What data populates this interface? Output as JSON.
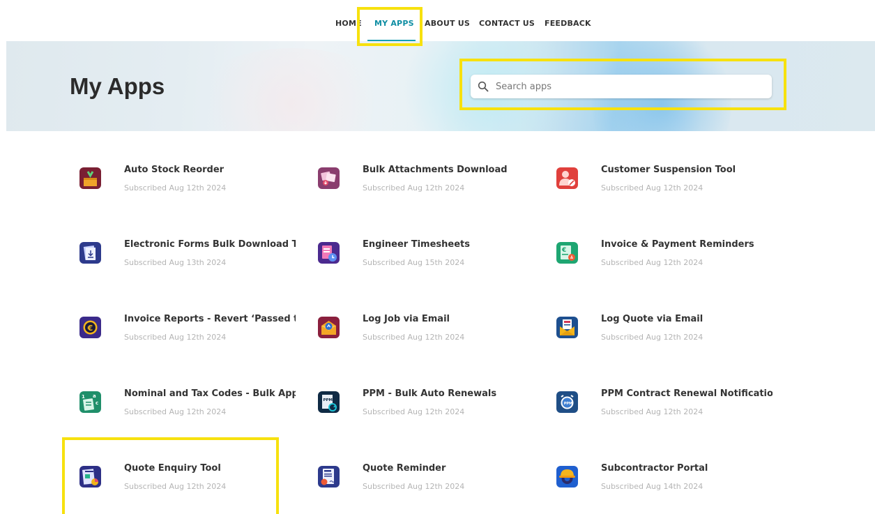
{
  "nav": {
    "items": [
      {
        "label": "HOME"
      },
      {
        "label": "MY APPS"
      },
      {
        "label": "ABOUT US"
      },
      {
        "label": "CONTACT US"
      },
      {
        "label": "FEEDBACK"
      }
    ],
    "active": "MY APPS"
  },
  "hero": {
    "title": "My Apps"
  },
  "search": {
    "placeholder": "Search apps",
    "value": ""
  },
  "apps": [
    {
      "name": "Auto Stock Reorder",
      "subscribed": "Subscribed Aug 12th 2024",
      "icon": "stock-box-icon"
    },
    {
      "name": "Bulk Attachments Download",
      "subscribed": "Subscribed Aug 12th 2024",
      "icon": "attachments-icon"
    },
    {
      "name": "Customer Suspension Tool",
      "subscribed": "Subscribed Aug 12th 2024",
      "icon": "user-block-icon"
    },
    {
      "name": "Electronic Forms Bulk Download Tool",
      "subscribed": "Subscribed Aug 13th 2024",
      "icon": "forms-download-icon"
    },
    {
      "name": "Engineer Timesheets",
      "subscribed": "Subscribed Aug 15th 2024",
      "icon": "timesheet-icon"
    },
    {
      "name": "Invoice & Payment Reminders",
      "subscribed": "Subscribed Aug 12th 2024",
      "icon": "invoice-reminder-icon"
    },
    {
      "name": "Invoice Reports - Revert ‘Passed to Accounts’",
      "subscribed": "Subscribed Aug 12th 2024",
      "icon": "euro-coin-icon"
    },
    {
      "name": "Log Job via Email",
      "subscribed": "Subscribed Aug 12th 2024",
      "icon": "job-email-icon"
    },
    {
      "name": "Log Quote via Email",
      "subscribed": "Subscribed Aug 12th 2024",
      "icon": "quote-email-icon"
    },
    {
      "name": "Nominal and Tax Codes - Bulk Apply",
      "subscribed": "Subscribed Aug 12th 2024",
      "icon": "tax-codes-icon"
    },
    {
      "name": "PPM - Bulk Auto Renewals",
      "subscribed": "Subscribed Aug 12th 2024",
      "icon": "ppm-renew-icon"
    },
    {
      "name": "PPM Contract Renewal Notifications",
      "subscribed": "Subscribed Aug 12th 2024",
      "icon": "ppm-alarm-icon"
    },
    {
      "name": "Quote Enquiry Tool",
      "subscribed": "Subscribed Aug 12th 2024",
      "icon": "quote-enquiry-icon"
    },
    {
      "name": "Quote Reminder",
      "subscribed": "Subscribed Aug 12th 2024",
      "icon": "quote-reminder-icon"
    },
    {
      "name": "Subcontractor Portal",
      "subscribed": "Subscribed Aug 14th 2024",
      "icon": "hardhat-gear-icon"
    }
  ],
  "colors": {
    "accent": "#17a0b5",
    "highlight": "#f7e10e",
    "muted_text": "#b4b4b4"
  }
}
